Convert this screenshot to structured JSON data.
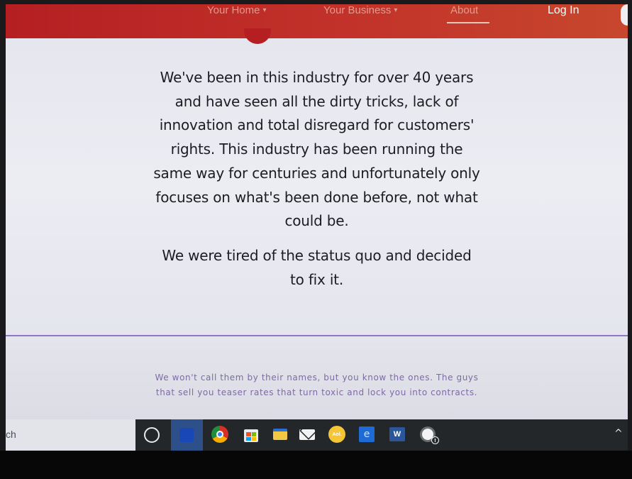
{
  "nav": {
    "items": [
      {
        "label": "Your Home",
        "caret": "▾"
      },
      {
        "label": "Your Business",
        "caret": "▾"
      },
      {
        "label": "About"
      }
    ],
    "login_label": "Log In"
  },
  "main": {
    "paragraph_1": [
      "We've been in this industry for over 40 years",
      "and have seen all the dirty tricks, lack of",
      "innovation and total disregard for customers'",
      "rights. This industry has been running the",
      "same way for centuries and unfortunately only",
      "focuses on what's been done before, not what",
      "could be."
    ],
    "paragraph_2": [
      "We were tired of the status quo and decided",
      "to fix it."
    ]
  },
  "lower": {
    "caption": [
      "We won't call them by their names, but you know the ones. The guys",
      "that sell you teaser rates that turn toxic and lock you into contracts."
    ]
  },
  "taskbar": {
    "search_text": "ch",
    "aol_label": "Aol.",
    "word_label": "W",
    "tray_chevron": "^",
    "icons": [
      "cortana-icon",
      "task-view-icon",
      "chrome-icon",
      "store-icon",
      "file-explorer-icon",
      "mail-icon",
      "aol-icon",
      "edge-icon",
      "word-icon",
      "weather-icon"
    ]
  },
  "colors": {
    "nav_red": "#b51f22",
    "body_text": "#1c1c22",
    "caption_purple": "#7e6aa4",
    "divider_purple": "#8f79c2",
    "taskbar": "#232729"
  }
}
